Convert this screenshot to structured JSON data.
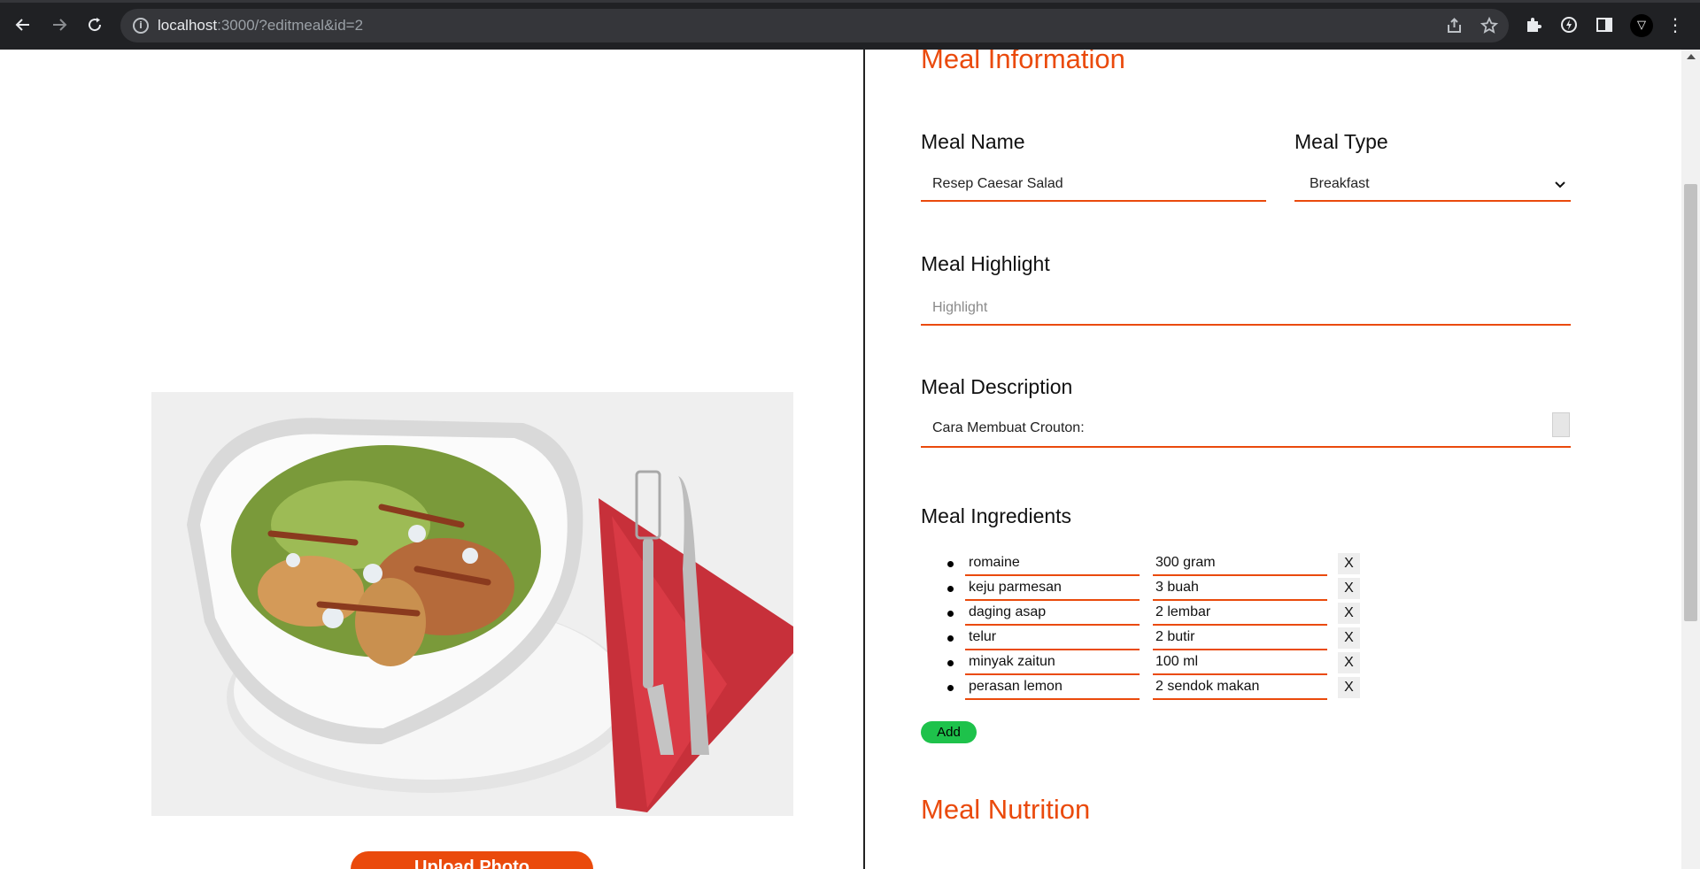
{
  "browser": {
    "url_host": "localhost",
    "url_path": ":3000/?editmeal&id=2",
    "icons": [
      "back-icon",
      "forward-icon",
      "reload-icon",
      "site-info-icon",
      "share-icon",
      "bookmark-star-icon",
      "extensions-icon",
      "extension-icon",
      "side-panel-icon",
      "profile-avatar",
      "more-menu-icon"
    ]
  },
  "left": {
    "photo_alt": "Caesar salad in white bowl with fork and knife on red napkin",
    "upload_label": "Upload Photo"
  },
  "form": {
    "section_info": "Meal Information",
    "meal_name_label": "Meal Name",
    "meal_name_value": "Resep Caesar Salad",
    "meal_type_label": "Meal Type",
    "meal_type_value": "Breakfast",
    "highlight_label": "Meal Highlight",
    "highlight_placeholder": "Highlight",
    "description_label": "Meal Description",
    "description_value": "Cara Membuat Crouton:",
    "ingredients_label": "Meal Ingredients",
    "ingredients": [
      {
        "name": "romaine",
        "qty": "300 gram",
        "remove": "X"
      },
      {
        "name": "keju parmesan",
        "qty": "3 buah",
        "remove": "X"
      },
      {
        "name": "daging asap",
        "qty": "2 lembar",
        "remove": "X"
      },
      {
        "name": "telur",
        "qty": "2 butir",
        "remove": "X"
      },
      {
        "name": "minyak zaitun",
        "qty": "100 ml",
        "remove": "X"
      },
      {
        "name": "perasan lemon",
        "qty": "2 sendok makan",
        "remove": "X"
      }
    ],
    "add_label": "Add",
    "section_nutrition": "Meal Nutrition"
  },
  "colors": {
    "accent": "#ea4a0c",
    "add_button": "#1ec24b",
    "chrome_bg": "#202124"
  }
}
